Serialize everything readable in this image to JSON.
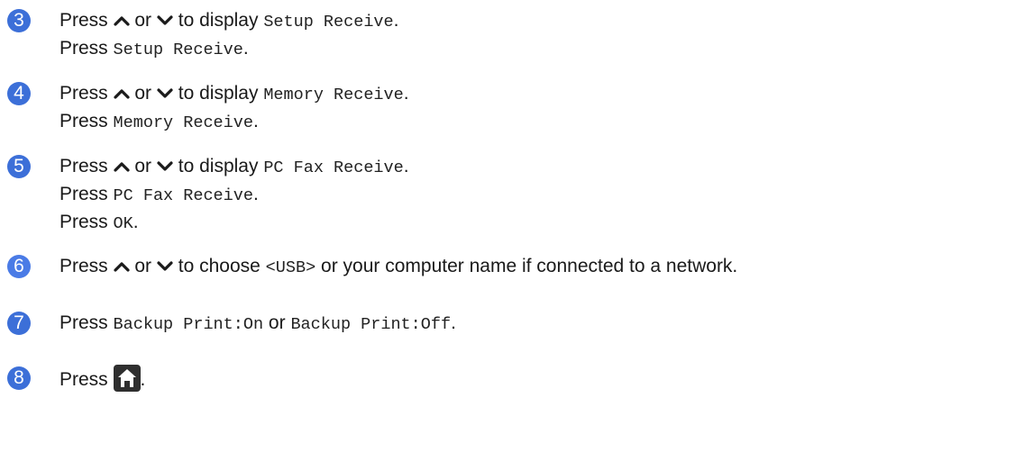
{
  "colors": {
    "badge": "#3c6fd8",
    "badge_6": "#4a7be6"
  },
  "steps": [
    {
      "number": "3",
      "line1": {
        "press": "Press",
        "or": "or",
        "to_display": "to display",
        "target": "Setup Receive",
        "end": "."
      },
      "line2": {
        "press": "Press",
        "target": "Setup Receive",
        "end": "."
      }
    },
    {
      "number": "4",
      "line1": {
        "press": "Press",
        "or": "or",
        "to_display": "to display",
        "target": "Memory Receive",
        "end": "."
      },
      "line2": {
        "press": "Press",
        "target": "Memory Receive",
        "end": "."
      }
    },
    {
      "number": "5",
      "line1": {
        "press": "Press",
        "or": "or",
        "to_display": "to display",
        "target": "PC Fax Receive",
        "end": "."
      },
      "line2": {
        "press": "Press",
        "target": "PC Fax Receive",
        "end": "."
      },
      "line3": {
        "press": "Press",
        "target": "OK",
        "end": "."
      }
    },
    {
      "number": "6",
      "line1": {
        "press": "Press",
        "or": "or",
        "to_choose": "to choose",
        "target": "<USB>",
        "rest": "or your computer name if connected to a network."
      }
    },
    {
      "number": "7",
      "line1": {
        "press": "Press",
        "option1": "Backup Print:On",
        "or": "or",
        "option2": "Backup Print:Off",
        "end": "."
      }
    },
    {
      "number": "8",
      "line1": {
        "press": "Press",
        "icon": "home-icon",
        "end": "."
      }
    }
  ]
}
